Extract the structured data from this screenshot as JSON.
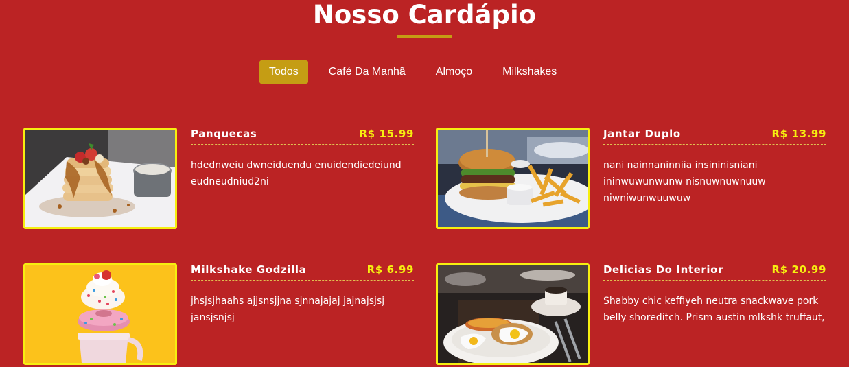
{
  "header": {
    "title": "Nosso Cardápio"
  },
  "tabs": [
    {
      "label": "Todos",
      "active": true
    },
    {
      "label": "Café Da Manhã",
      "active": false
    },
    {
      "label": "Almoço",
      "active": false
    },
    {
      "label": "Milkshakes",
      "active": false
    }
  ],
  "menu": {
    "items": [
      {
        "name": "Panquecas",
        "price": "R$ 15.99",
        "description": "hdednweiu dwneiduendu enuidendiedeiund eudneudniud2ni",
        "image": "pancakes-image"
      },
      {
        "name": "Jantar Duplo",
        "price": "R$ 13.99",
        "description": "nani nainnaninniia insininisniani ininwuwunwunw nisnuwnuwnuuw niwniwunwuuwuw",
        "image": "burger-fries-image"
      },
      {
        "name": "Milkshake Godzilla",
        "price": "R$ 6.99",
        "description": "jhsjsjhaahs ajjsnsjjna sjnnajajaj jajnajsjsj jansjsnjsj",
        "image": "milkshake-image"
      },
      {
        "name": "Delicias Do Interior",
        "price": "R$ 20.99",
        "description": "Shabby chic keffiyeh neutra snackwave pork belly shoreditch. Prism austin mlkshk truffaut,",
        "image": "breakfast-eggs-image"
      }
    ]
  },
  "colors": {
    "background": "#bb2324",
    "accent": "#c59d14",
    "price": "#f6ef10",
    "image_border": "#f6ef10"
  }
}
